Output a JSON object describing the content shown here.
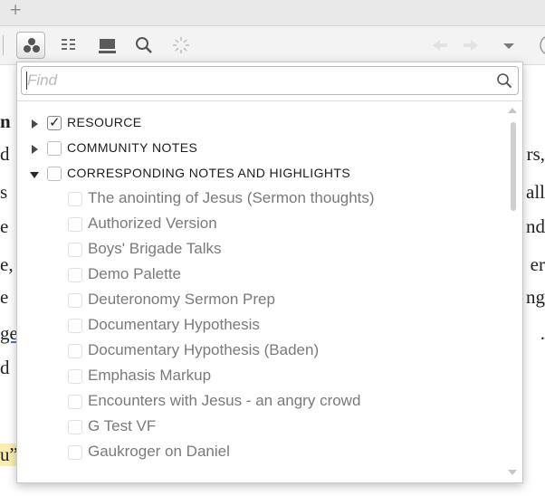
{
  "tabstrip": {
    "add_label": "+"
  },
  "toolbar": {
    "buttons": [
      "panels-icon",
      "layout-icon",
      "panel-icon",
      "search-icon",
      "loading-icon"
    ],
    "nav": [
      "back-arrow-icon",
      "forward-arrow-icon",
      "dropdown-arrow-icon"
    ]
  },
  "background_doc": {
    "left_fragments": [
      "n",
      "d",
      "s",
      "e",
      "e,",
      "e",
      "ge",
      "d",
      "",
      "u”"
    ],
    "right_fragments": [
      "",
      "rs,",
      "all",
      "nd",
      "er",
      "ng",
      "."
    ]
  },
  "find": {
    "placeholder": "Find",
    "value": ""
  },
  "categories": [
    {
      "label": "RESOURCE",
      "checked": true,
      "expanded": false
    },
    {
      "label": "COMMUNITY NOTES",
      "checked": false,
      "expanded": false
    },
    {
      "label": "CORRESPONDING NOTES AND HIGHLIGHTS",
      "checked": false,
      "expanded": true
    }
  ],
  "items": [
    "The anointing of Jesus (Sermon thoughts)",
    "Authorized Version",
    "Boys' Brigade Talks",
    "Demo Palette",
    "Deuteronomy Sermon Prep",
    "Documentary Hypothesis",
    "Documentary Hypothesis (Baden)",
    "Emphasis Markup",
    "Encounters with Jesus - an angry crowd",
    "G Test VF",
    "Gaukroger on Daniel"
  ],
  "colors": {
    "accent_underline": "#3f7bd6",
    "highlight": "#fbeeb0"
  }
}
